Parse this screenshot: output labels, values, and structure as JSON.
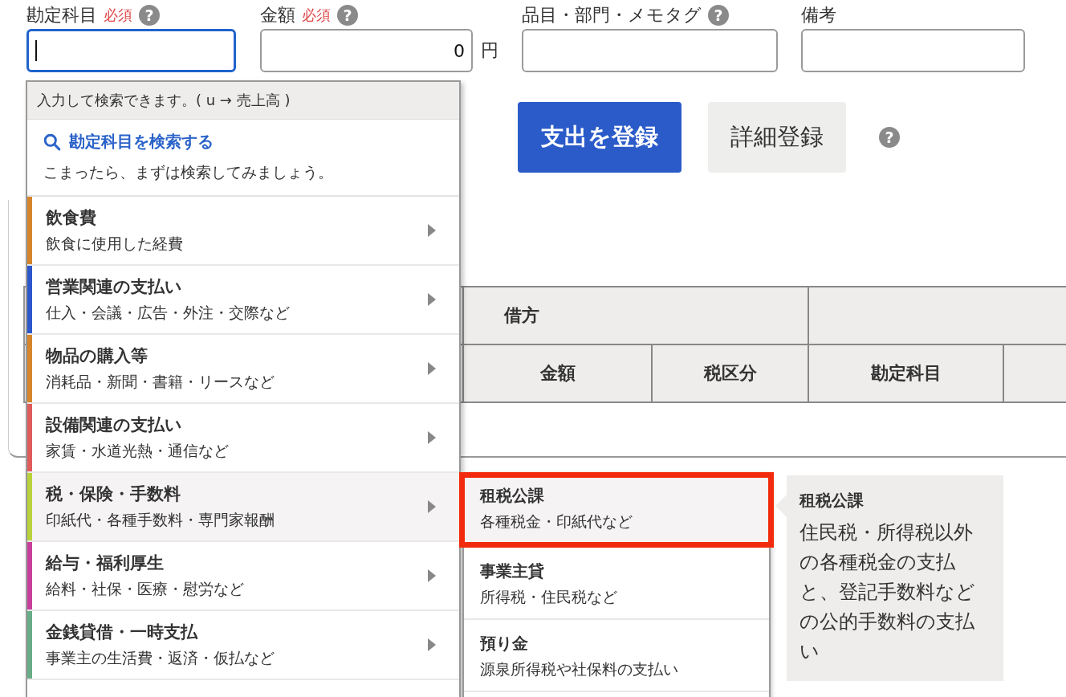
{
  "fields": [
    {
      "kind": "text",
      "label": "勘定科目",
      "required": "必須",
      "help": "?",
      "focused": true
    },
    {
      "kind": "amount",
      "label": "金額",
      "required": "必須",
      "help": "?",
      "value": "0",
      "unit": "円",
      "focused": false
    },
    {
      "kind": "text",
      "label": "品目・部門・メモタグ",
      "help": "?",
      "focused": false
    },
    {
      "kind": "text",
      "label": "備考",
      "focused": false
    }
  ],
  "buttons": [
    {
      "kind": "primary",
      "label": "支出を登録"
    },
    {
      "kind": "secondary",
      "label": "詳細登録"
    }
  ],
  "buttons_help": "?",
  "table": {
    "group_header": "借方",
    "columns": [
      "金額",
      "税区分",
      "勘定科目"
    ]
  },
  "dropdown": {
    "hint": "入力して検索できます。( u → 売上高 )",
    "search_link": "勘定科目を検索する",
    "search_note": "こまったら、まずは検索してみましょう。",
    "categories": [
      {
        "title": "飲食費",
        "subtitle": "飲食に使用した経費",
        "color": "#d6852c",
        "selected": false
      },
      {
        "title": "営業関連の支払い",
        "subtitle": "仕入・会議・広告・外注・交際など",
        "color": "#2d58cc",
        "selected": false
      },
      {
        "title": "物品の購入等",
        "subtitle": "消耗品・新聞・書籍・リースなど",
        "color": "#d6852c",
        "selected": false
      },
      {
        "title": "設備関連の支払い",
        "subtitle": "家賃・水道光熱・通信など",
        "color": "#e05c5c",
        "selected": false
      },
      {
        "title": "税・保険・手数料",
        "subtitle": "印紙代・各種手数料・専門家報酬",
        "color": "#b9d23c",
        "selected": true
      },
      {
        "title": "給与・福利厚生",
        "subtitle": "給料・社保・医療・慰労など",
        "color": "#c8409c",
        "selected": false
      },
      {
        "title": "金銭貸借・一時支払",
        "subtitle": "事業主の生活費・返済・仮払など",
        "color": "#68ac88",
        "selected": false
      }
    ]
  },
  "submenu": {
    "items": [
      {
        "title": "租税公課",
        "subtitle": "各種税金・印紙代など",
        "selected": true
      },
      {
        "title": "事業主貸",
        "subtitle": "所得税・住民税など",
        "selected": false
      },
      {
        "title": "預り金",
        "subtitle": "源泉所得税や社保料の支払い",
        "selected": false
      }
    ]
  },
  "tooltip": {
    "title": "租税公課",
    "body": "住民税・所得税以外の各種税金の支払と、登記手数料などの公的手数料の支払い"
  }
}
